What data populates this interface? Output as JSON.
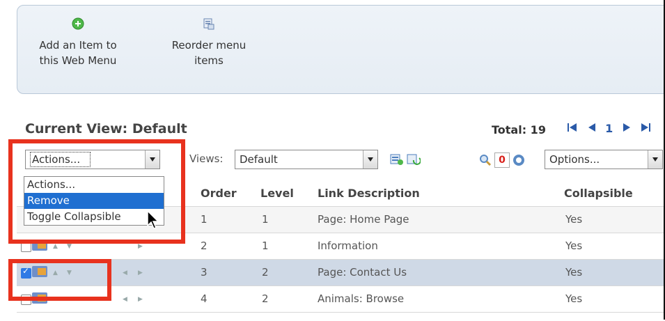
{
  "toolbar": {
    "add_item_label_1": "Add an Item to",
    "add_item_label_2": "this Web Menu",
    "reorder_label_1": "Reorder menu",
    "reorder_label_2": "items"
  },
  "grid": {
    "view_title": "Current View: Default",
    "total": "Total: 19",
    "page": "1",
    "actions_value": "Actions...",
    "views_label": "Views:",
    "views_value": "Default",
    "filter_count": "0",
    "options_value": "Options...",
    "actions_menu": [
      "Actions...",
      "Remove",
      "Toggle Collapsible"
    ],
    "columns": [
      "Order",
      "Level",
      "Link Description",
      "Collapsible"
    ],
    "rows": [
      {
        "order": "1",
        "level": "1",
        "description": "Page: Home Page",
        "collapsible": "Yes",
        "checked": false
      },
      {
        "order": "2",
        "level": "1",
        "description": "Information",
        "collapsible": "Yes",
        "checked": false
      },
      {
        "order": "3",
        "level": "2",
        "description": "Page: Contact Us",
        "collapsible": "Yes",
        "checked": true
      },
      {
        "order": "4",
        "level": "2",
        "description": "Animals: Browse",
        "collapsible": "Yes",
        "checked": false
      }
    ]
  },
  "colors": {
    "highlight": "#e8321e",
    "selected_row": "#cfd9e6",
    "menu_selection": "#1f6fd1"
  }
}
